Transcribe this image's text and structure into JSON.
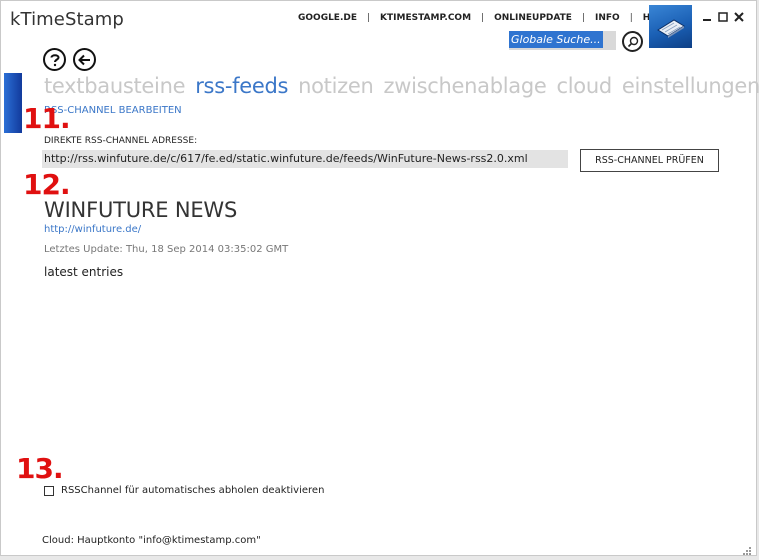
{
  "window": {
    "title": "kTimeStamp"
  },
  "topnav": {
    "links": [
      "GOOGLE.DE",
      "KTIMESTAMP.COM",
      "ONLINEUPDATE",
      "INFO",
      "HILFE"
    ],
    "separator": "|"
  },
  "window_controls": {
    "minimize": "–",
    "maximize": "□",
    "close": "✕"
  },
  "search": {
    "value": "Globale Suche..."
  },
  "tabs": [
    {
      "label": "textbausteine",
      "active": false
    },
    {
      "label": "rss-feeds",
      "active": true
    },
    {
      "label": "notizen",
      "active": false
    },
    {
      "label": "zwischenablage",
      "active": false
    },
    {
      "label": "cloud",
      "active": false
    },
    {
      "label": "einstellungen",
      "active": false
    }
  ],
  "sub_nav": {
    "label": "RSS-CHANNEL BEARBEITEN"
  },
  "steps": {
    "s11": "11.",
    "s12": "12.",
    "s13": "13."
  },
  "rss_form": {
    "label": "DIREKTE RSS-CHANNEL ADRESSE:",
    "url": "http://rss.winfuture.de/c/617/fe.ed/static.winfuture.de/feeds/WinFuture-News-rss2.0.xml",
    "check_button": "RSS-CHANNEL PRÜFEN"
  },
  "feed": {
    "title": "WINFUTURE NEWS",
    "link": "http://winfuture.de/",
    "last_update": "Letztes Update: Thu, 18 Sep 2014 03:35:02 GMT",
    "entries_label": "latest entries"
  },
  "options": {
    "disable_auto_fetch": "RSSChannel für automatisches abholen deaktivieren",
    "disable_auto_fetch_checked": false
  },
  "status": {
    "cloud": "Cloud: Hauptkonto \"info@ktimestamp.com\""
  },
  "colors": {
    "accent": "#3b77c8",
    "step_red": "#e01010",
    "inactive_tab": "#c8c8c8"
  }
}
